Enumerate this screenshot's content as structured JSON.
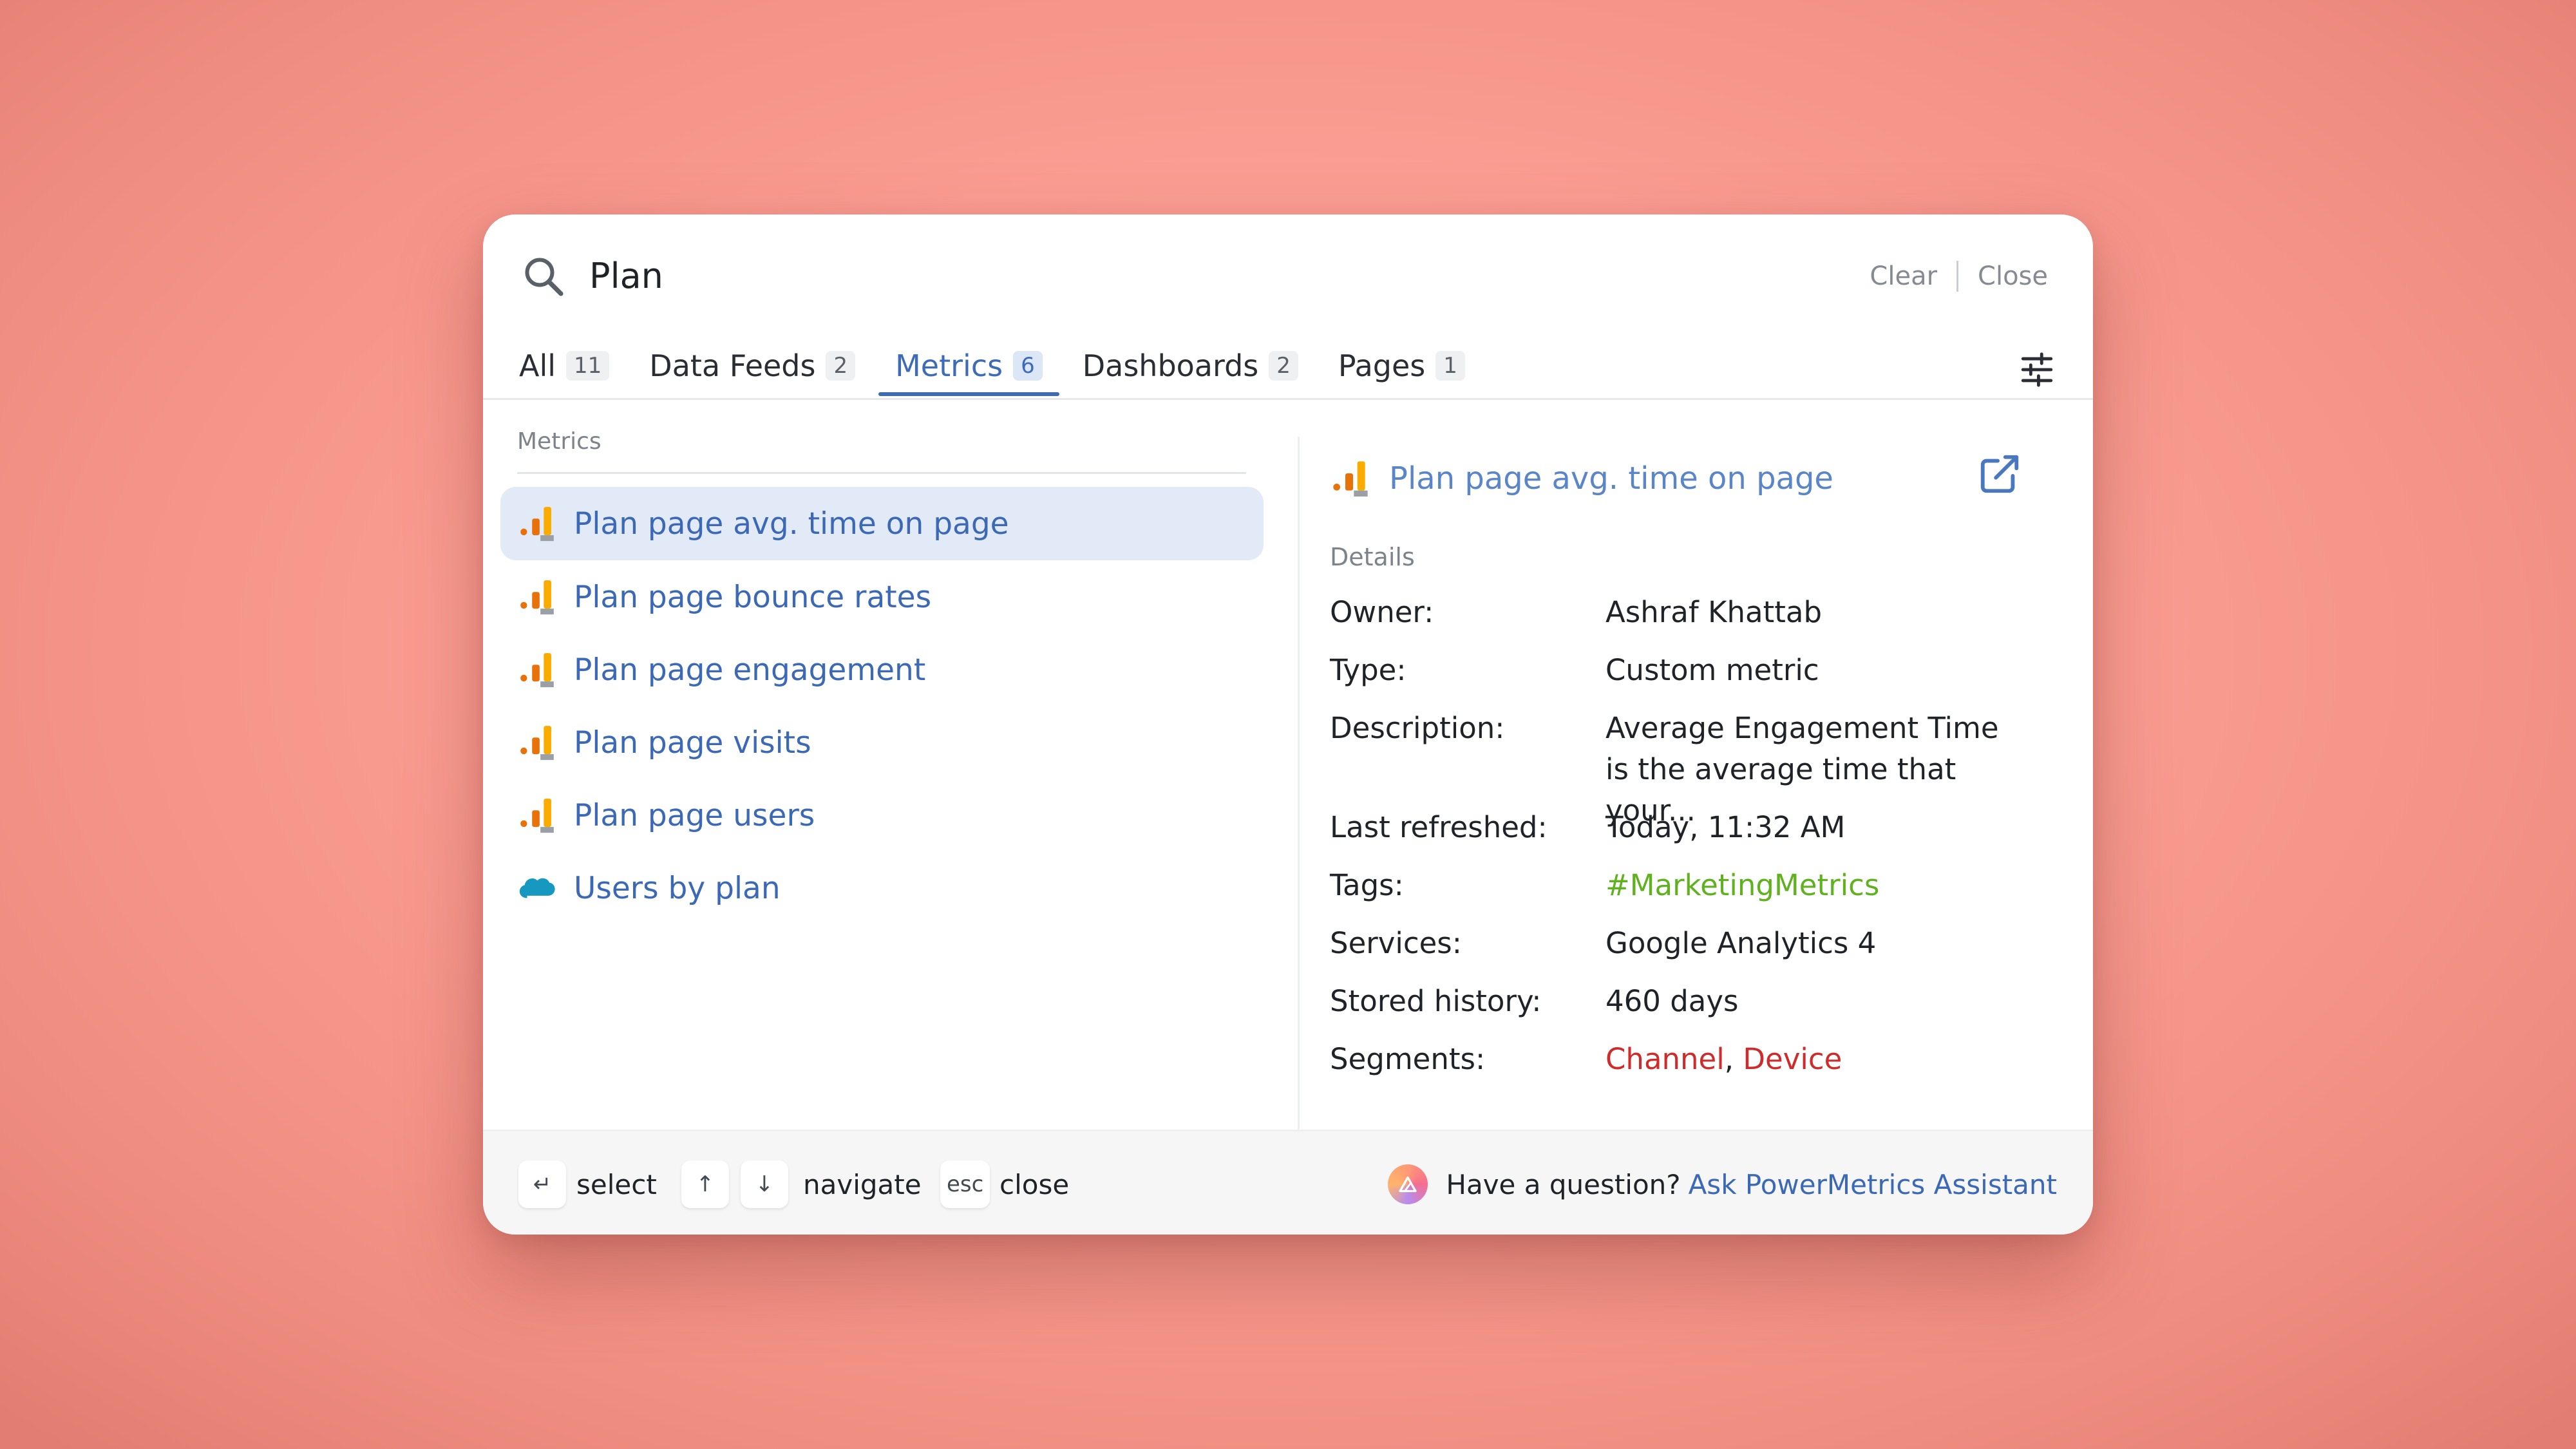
{
  "search": {
    "value": "Plan"
  },
  "top_actions": {
    "clear": "Clear",
    "close": "Close"
  },
  "tabs": [
    {
      "label": "All",
      "count": "11"
    },
    {
      "label": "Data Feeds",
      "count": "2"
    },
    {
      "label": "Metrics",
      "count": "6",
      "active": true
    },
    {
      "label": "Dashboards",
      "count": "2"
    },
    {
      "label": "Pages",
      "count": "1"
    }
  ],
  "results": {
    "section_label": "Metrics",
    "items": [
      {
        "label": "Plan page avg. time on page",
        "icon": "google-analytics-icon",
        "selected": true
      },
      {
        "label": "Plan page bounce rates",
        "icon": "google-analytics-icon"
      },
      {
        "label": "Plan page engagement",
        "icon": "google-analytics-icon"
      },
      {
        "label": "Plan page visits",
        "icon": "google-analytics-icon"
      },
      {
        "label": "Plan page users",
        "icon": "google-analytics-icon"
      },
      {
        "label": "Users by plan",
        "icon": "salesforce-icon"
      }
    ]
  },
  "detail": {
    "title": "Plan page avg. time on page",
    "details_label": "Details",
    "owner": {
      "key": "Owner:",
      "value": "Ashraf Khattab"
    },
    "type": {
      "key": "Type:",
      "value": "Custom metric"
    },
    "description": {
      "key": "Description:",
      "value": "Average Engagement Time is the average time that your..."
    },
    "last_refreshed": {
      "key": "Last refreshed:",
      "value": "Today, 11:32 AM"
    },
    "tags": {
      "key": "Tags:",
      "value": "#MarketingMetrics"
    },
    "services": {
      "key": "Services:",
      "value": "Google Analytics 4"
    },
    "stored_history": {
      "key": "Stored history:",
      "value": "460 days"
    },
    "segments": {
      "key": "Segments:",
      "values": [
        "Channel",
        "Device"
      ],
      "separator": ", "
    }
  },
  "footer": {
    "select_key": "↵",
    "select_label": "select",
    "up_key": "↑",
    "down_key": "↓",
    "navigate_label": "navigate",
    "esc_key": "esc",
    "close_label": "close",
    "question": "Have a question?",
    "assistant_link": "Ask PowerMetrics Assistant"
  },
  "colors": {
    "accent": "#3e6bb8",
    "tag": "#5fb21e",
    "segment": "#cf2b2b",
    "background": "#fb9d92"
  }
}
